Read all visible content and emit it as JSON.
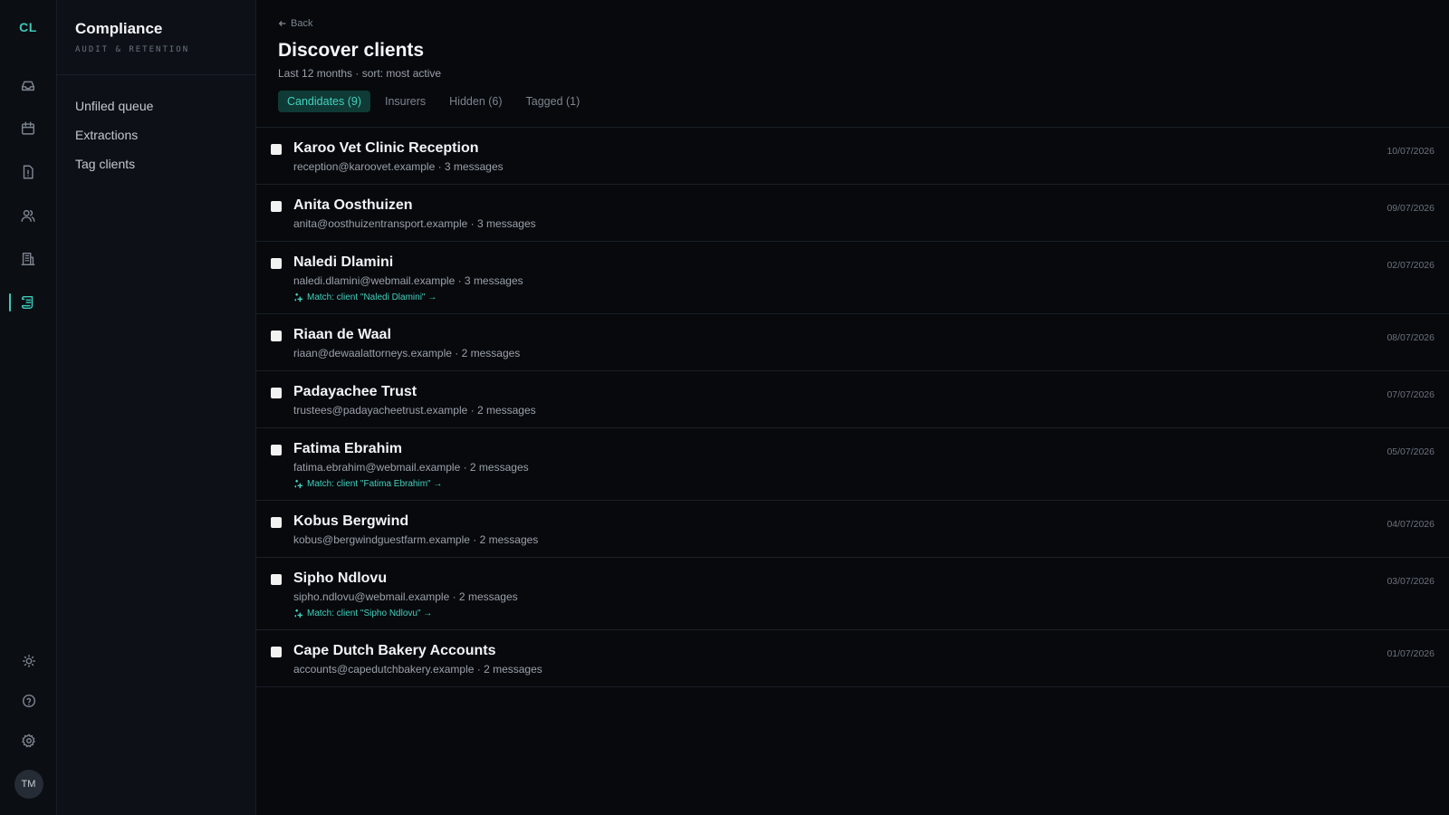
{
  "rail": {
    "logo": "CL",
    "top_icons": [
      "inbox-icon",
      "calendar-icon",
      "alert-file-icon",
      "users-icon",
      "building-icon",
      "scroll-icon"
    ],
    "active_index": 5,
    "bottom_icons": [
      "sun-icon",
      "help-icon",
      "gear-icon"
    ],
    "avatar_initials": "TM"
  },
  "sidebar": {
    "title": "Compliance",
    "subtitle": "AUDIT & RETENTION",
    "items": [
      {
        "label": "Unfiled queue"
      },
      {
        "label": "Extractions"
      },
      {
        "label": "Tag clients"
      }
    ]
  },
  "header": {
    "back_label": "Back",
    "title": "Discover clients",
    "subtitle": "Last 12 months · sort: most active",
    "tabs": [
      {
        "label": "Candidates (9)",
        "active": true
      },
      {
        "label": "Insurers",
        "active": false
      },
      {
        "label": "Hidden (6)",
        "active": false
      },
      {
        "label": "Tagged (1)",
        "active": false
      }
    ]
  },
  "colors": {
    "accent": "#43d1bd",
    "background": "#07090d",
    "sidebar": "#0d1117"
  },
  "rows": [
    {
      "name": "Karoo Vet Clinic Reception",
      "meta": "reception@karoovet.example · 3 messages",
      "date": "10/07/2026",
      "match": ""
    },
    {
      "name": "Anita Oosthuizen",
      "meta": "anita@oosthuizentransport.example · 3 messages",
      "date": "09/07/2026",
      "match": ""
    },
    {
      "name": "Naledi Dlamini",
      "meta": "naledi.dlamini@webmail.example · 3 messages",
      "date": "02/07/2026",
      "match": "Match: client \"Naledi Dlamini\" →"
    },
    {
      "name": "Riaan de Waal",
      "meta": "riaan@dewaalattorneys.example · 2 messages",
      "date": "08/07/2026",
      "match": ""
    },
    {
      "name": "Padayachee Trust",
      "meta": "trustees@padayacheetrust.example · 2 messages",
      "date": "07/07/2026",
      "match": ""
    },
    {
      "name": "Fatima Ebrahim",
      "meta": "fatima.ebrahim@webmail.example · 2 messages",
      "date": "05/07/2026",
      "match": "Match: client \"Fatima Ebrahim\" →"
    },
    {
      "name": "Kobus Bergwind",
      "meta": "kobus@bergwindguestfarm.example · 2 messages",
      "date": "04/07/2026",
      "match": ""
    },
    {
      "name": "Sipho Ndlovu",
      "meta": "sipho.ndlovu@webmail.example · 2 messages",
      "date": "03/07/2026",
      "match": "Match: client \"Sipho Ndlovu\" →"
    },
    {
      "name": "Cape Dutch Bakery Accounts",
      "meta": "accounts@capedutchbakery.example · 2 messages",
      "date": "01/07/2026",
      "match": ""
    }
  ]
}
